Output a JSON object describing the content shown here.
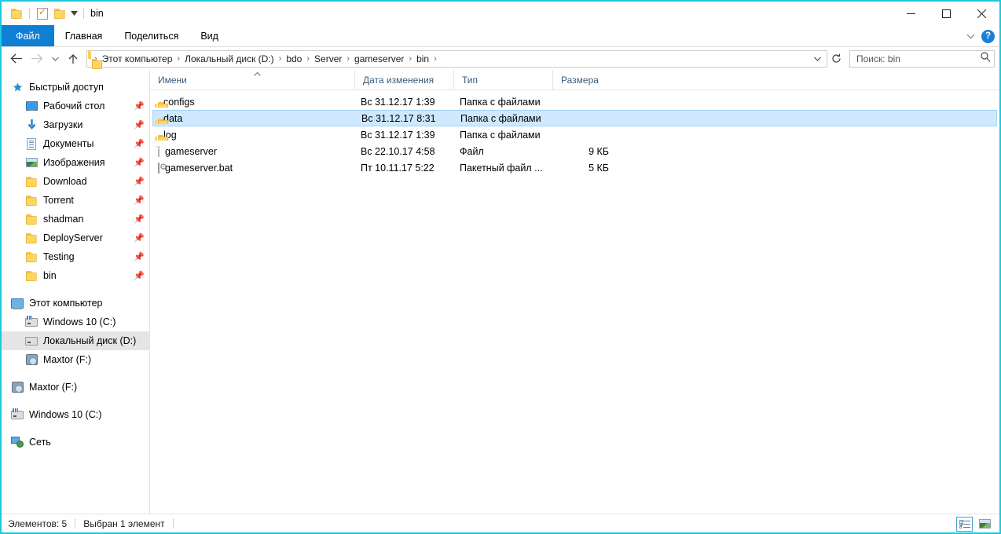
{
  "window": {
    "title": "bin",
    "border_color": "#1fc8dd",
    "quick_access": [
      {
        "name": "folder-icon",
        "label": ""
      },
      {
        "name": "properties-icon",
        "label": ""
      },
      {
        "name": "new-folder-icon",
        "label": ""
      },
      {
        "name": "customize-dropdown-icon",
        "label": ""
      }
    ],
    "controls": {
      "minimize": "—",
      "maximize": "☐",
      "close": "✕"
    }
  },
  "ribbon": {
    "tabs": [
      {
        "label": "Файл",
        "active": true
      },
      {
        "label": "Главная",
        "active": false
      },
      {
        "label": "Поделиться",
        "active": false
      },
      {
        "label": "Вид",
        "active": false
      }
    ],
    "collapse_label": "⌄",
    "help_label": "?"
  },
  "addressbar": {
    "back_label": "←",
    "forward_label": "→",
    "recent_label": "⌄",
    "up_label": "↑",
    "crumbs": [
      "Этот компьютер",
      "Локальный диск (D:)",
      "bdo",
      "Server",
      "gameserver",
      "bin"
    ],
    "separator": "›",
    "dropdown_label": "⌄",
    "refresh_label": "↻",
    "search_placeholder": "Поиск: bin",
    "search_value": "",
    "search_icon": "⚲"
  },
  "sidebar": {
    "quick_access": {
      "label": "Быстрый доступ",
      "icon": "star-icon"
    },
    "pinned": [
      {
        "label": "Рабочий стол",
        "icon": "desktop-icon",
        "pinned": true
      },
      {
        "label": "Загрузки",
        "icon": "downloads-icon",
        "pinned": true
      },
      {
        "label": "Документы",
        "icon": "documents-icon",
        "pinned": true
      },
      {
        "label": "Изображения",
        "icon": "pictures-icon",
        "pinned": true
      },
      {
        "label": "Download",
        "icon": "folder-icon",
        "pinned": true
      },
      {
        "label": "Torrent",
        "icon": "folder-icon",
        "pinned": true
      },
      {
        "label": "shadman",
        "icon": "folder-icon",
        "pinned": true
      },
      {
        "label": "DeployServer",
        "icon": "folder-icon",
        "pinned": true
      },
      {
        "label": "Testing",
        "icon": "folder-icon",
        "pinned": true
      },
      {
        "label": "bin",
        "icon": "folder-icon",
        "pinned": true
      }
    ],
    "this_pc": {
      "label": "Этот компьютер",
      "icon": "computer-icon"
    },
    "drives": [
      {
        "label": "Windows 10 (C:)",
        "icon": "windows-drive-icon",
        "selected": false
      },
      {
        "label": "Локальный диск (D:)",
        "icon": "drive-icon",
        "selected": true
      },
      {
        "label": "Maxtor (F:)",
        "icon": "hdd-icon",
        "selected": false
      }
    ],
    "root_items": [
      {
        "label": "Maxtor (F:)",
        "icon": "hdd-icon"
      },
      {
        "label": "Windows 10 (C:)",
        "icon": "windows-drive-icon"
      },
      {
        "label": "Сеть",
        "icon": "network-icon"
      }
    ]
  },
  "columns": {
    "name": "Имени",
    "date": "Дата изменения",
    "type": "Тип",
    "size": "Размера",
    "sort_caret": "▲",
    "sort_column": "name",
    "sort_direction": "asc"
  },
  "files": [
    {
      "name": "configs",
      "date": "Вс 31.12.17 1:39",
      "type": "Папка с файлами",
      "size": "",
      "icon": "folder-icon",
      "selected": false
    },
    {
      "name": "data",
      "date": "Вс 31.12.17 8:31",
      "type": "Папка с файлами",
      "size": "",
      "icon": "folder-icon",
      "selected": true
    },
    {
      "name": "log",
      "date": "Вс 31.12.17 1:39",
      "type": "Папка с файлами",
      "size": "",
      "icon": "folder-icon",
      "selected": false
    },
    {
      "name": "gameserver",
      "date": "Вс 22.10.17 4:58",
      "type": "Файл",
      "size": "9 КБ",
      "icon": "file-icon",
      "selected": false
    },
    {
      "name": "gameserver.bat",
      "date": "Пт 10.11.17 5:22",
      "type": "Пакетный файл ...",
      "size": "5 КБ",
      "icon": "batch-file-icon",
      "selected": false
    }
  ],
  "statusbar": {
    "count": "Элементов: 5",
    "selection": "Выбран 1 элемент",
    "view_details": "details-view",
    "view_icons": "large-icons-view",
    "active_view": "details"
  },
  "colors": {
    "accent": "#0f7fd4",
    "selection": "#cde8ff",
    "folder": "#fdd663",
    "border": "#1fc8dd"
  }
}
